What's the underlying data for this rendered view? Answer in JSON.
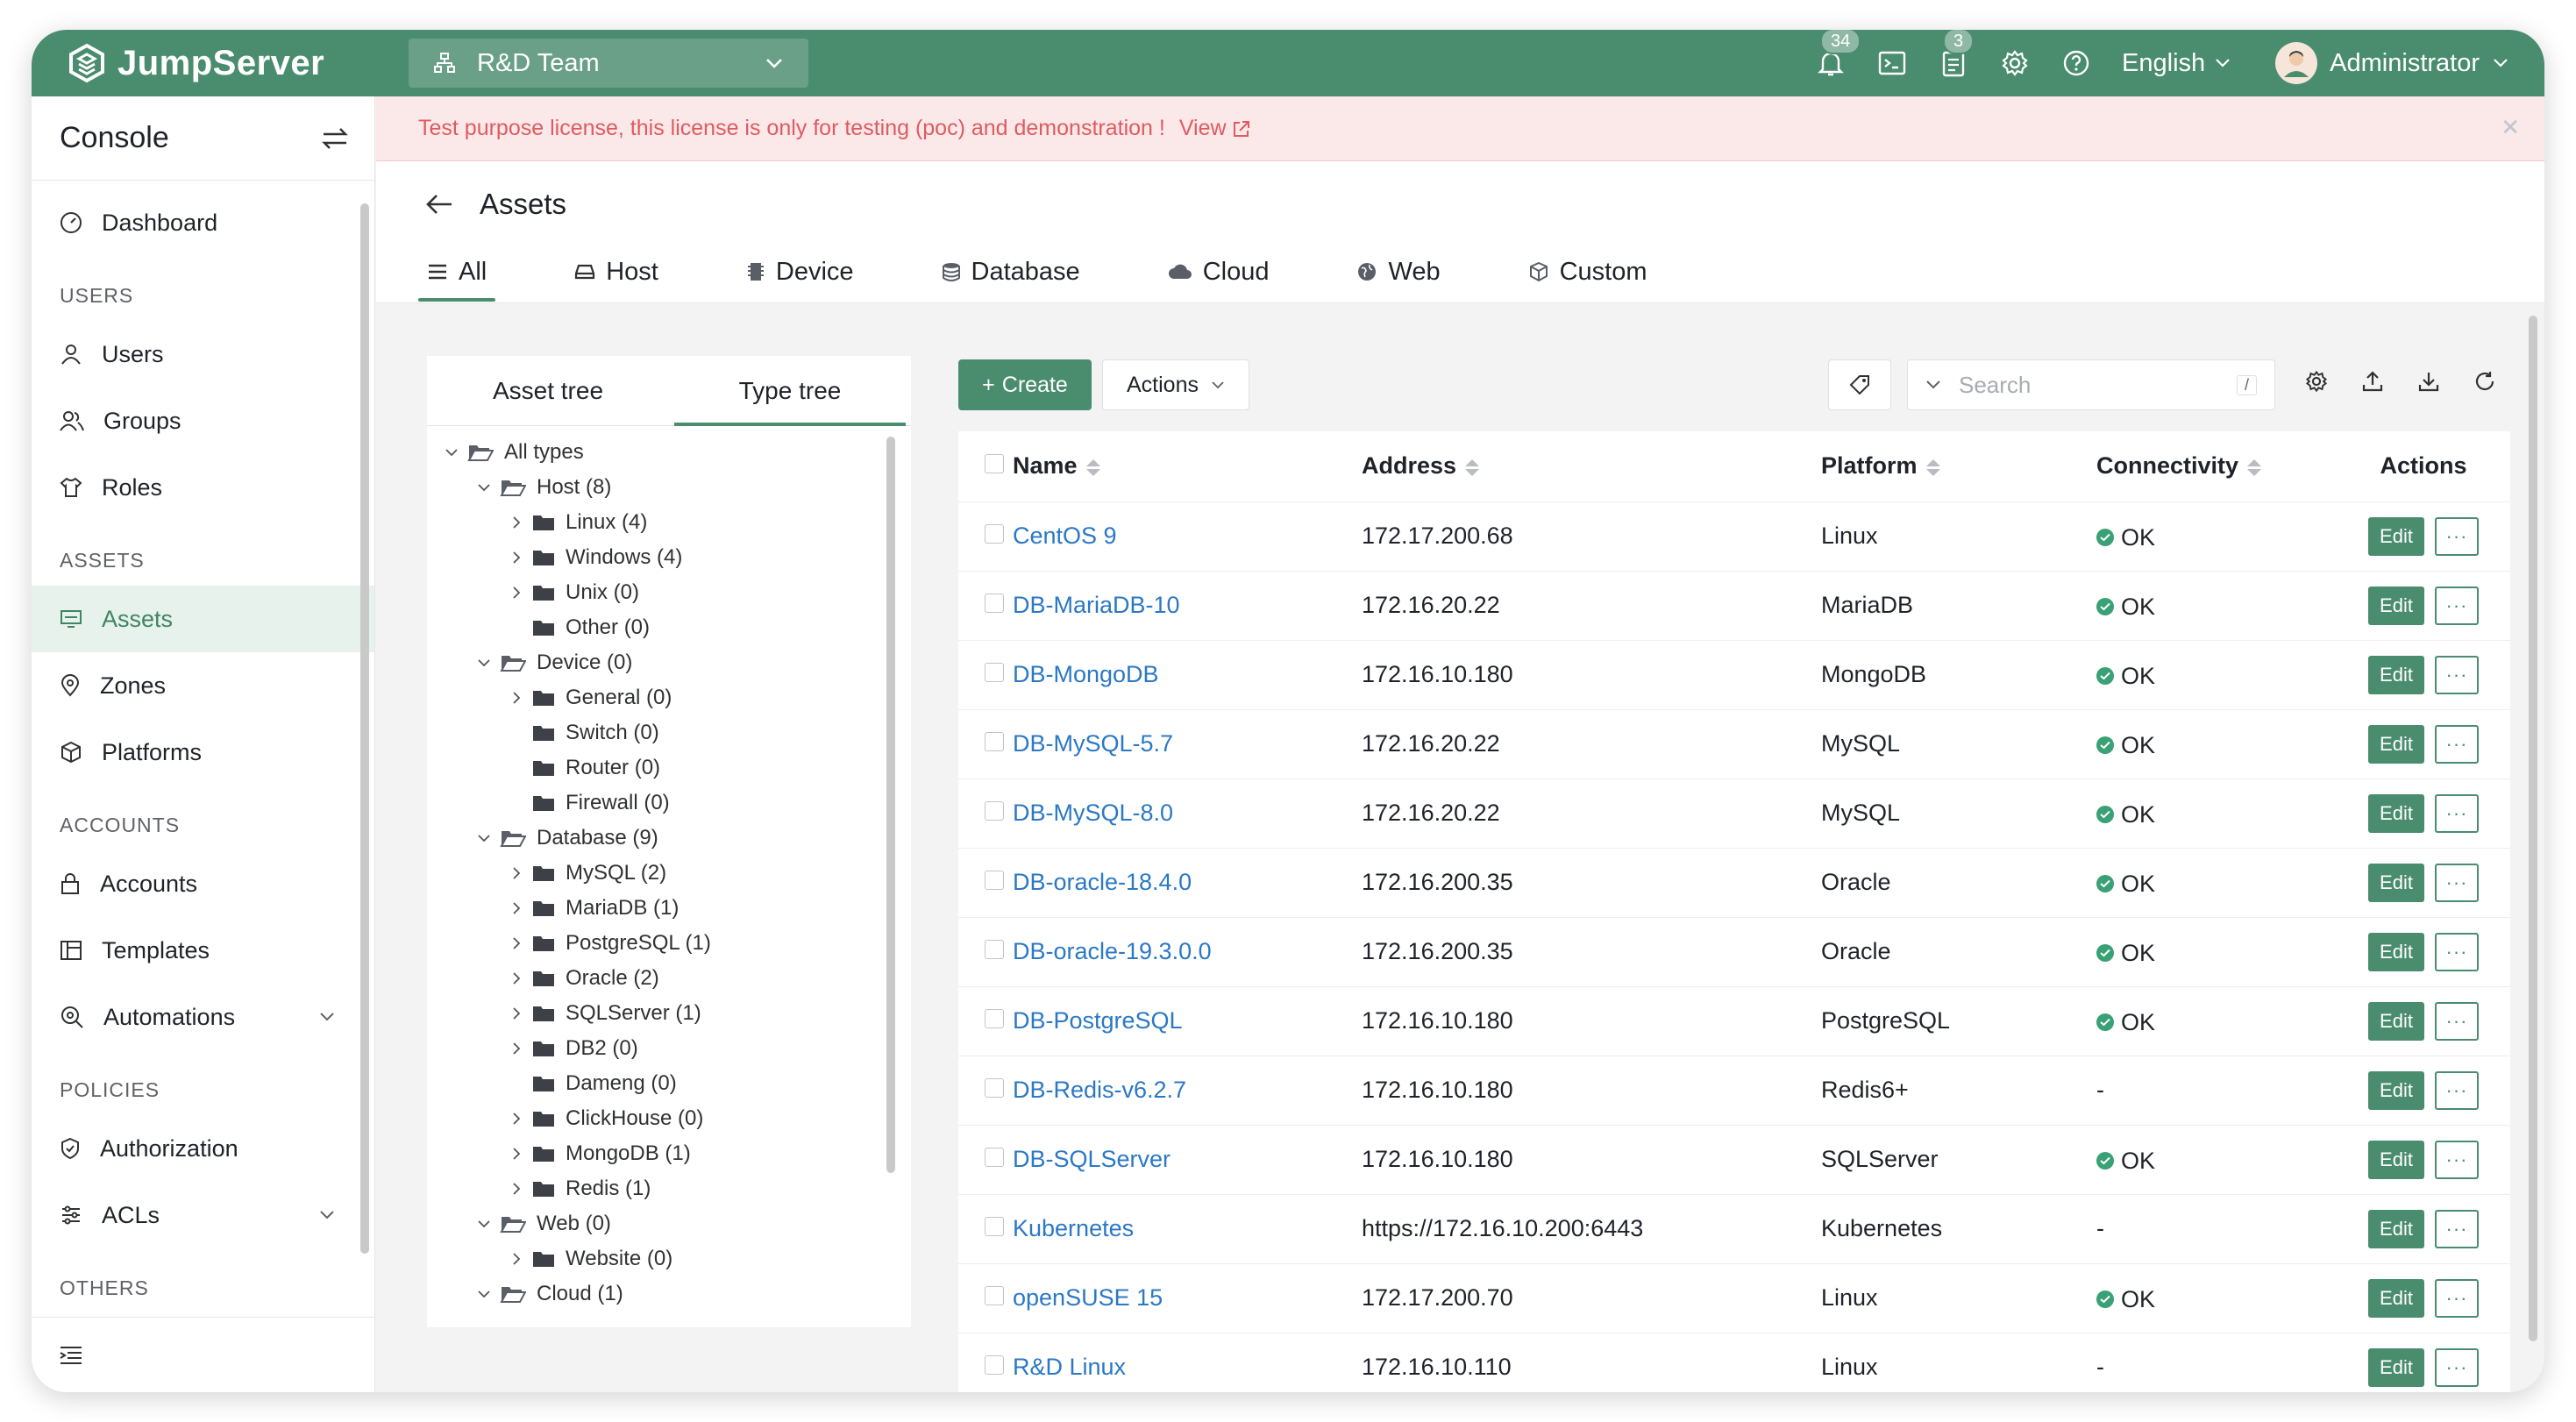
{
  "brand": {
    "name": "JumpServer"
  },
  "org": {
    "name": "R&D Team"
  },
  "header": {
    "notifications_count": "34",
    "tasks_count": "3",
    "language": "English",
    "user_name": "Administrator"
  },
  "sidebar": {
    "title": "Console",
    "sections": {
      "users": "USERS",
      "assets": "ASSETS",
      "accounts": "ACCOUNTS",
      "policies": "POLICIES",
      "others": "OTHERS"
    },
    "items": {
      "dashboard": "Dashboard",
      "users": "Users",
      "groups": "Groups",
      "roles": "Roles",
      "assets": "Assets",
      "zones": "Zones",
      "platforms": "Platforms",
      "accounts": "Accounts",
      "templates": "Templates",
      "automations": "Automations",
      "authorization": "Authorization",
      "acls": "ACLs"
    }
  },
  "license": {
    "message": "Test purpose license, this license is only for testing (poc) and demonstration !",
    "view": "View"
  },
  "page": {
    "title": "Assets",
    "tabs": [
      "All",
      "Host",
      "Device",
      "Database",
      "Cloud",
      "Web",
      "Custom"
    ]
  },
  "tree": {
    "tabs": [
      "Asset tree",
      "Type tree"
    ],
    "nodes": [
      {
        "label": "All types",
        "level": 0,
        "arrow": "down",
        "icon": "folder-open"
      },
      {
        "label": "Host (8)",
        "level": 1,
        "arrow": "down",
        "icon": "folder-open"
      },
      {
        "label": "Linux (4)",
        "level": 2,
        "arrow": "right",
        "icon": "folder"
      },
      {
        "label": "Windows (4)",
        "level": 2,
        "arrow": "right",
        "icon": "folder"
      },
      {
        "label": "Unix (0)",
        "level": 2,
        "arrow": "right",
        "icon": "folder"
      },
      {
        "label": "Other (0)",
        "level": 2,
        "arrow": "none",
        "icon": "folder"
      },
      {
        "label": "Device (0)",
        "level": 1,
        "arrow": "down",
        "icon": "folder-open"
      },
      {
        "label": "General (0)",
        "level": 2,
        "arrow": "right",
        "icon": "folder"
      },
      {
        "label": "Switch (0)",
        "level": 2,
        "arrow": "none",
        "icon": "folder"
      },
      {
        "label": "Router (0)",
        "level": 2,
        "arrow": "none",
        "icon": "folder"
      },
      {
        "label": "Firewall (0)",
        "level": 2,
        "arrow": "none",
        "icon": "folder"
      },
      {
        "label": "Database (9)",
        "level": 1,
        "arrow": "down",
        "icon": "folder-open"
      },
      {
        "label": "MySQL (2)",
        "level": 2,
        "arrow": "right",
        "icon": "folder"
      },
      {
        "label": "MariaDB (1)",
        "level": 2,
        "arrow": "right",
        "icon": "folder"
      },
      {
        "label": "PostgreSQL (1)",
        "level": 2,
        "arrow": "right",
        "icon": "folder"
      },
      {
        "label": "Oracle (2)",
        "level": 2,
        "arrow": "right",
        "icon": "folder"
      },
      {
        "label": "SQLServer (1)",
        "level": 2,
        "arrow": "right",
        "icon": "folder"
      },
      {
        "label": "DB2 (0)",
        "level": 2,
        "arrow": "right",
        "icon": "folder"
      },
      {
        "label": "Dameng (0)",
        "level": 2,
        "arrow": "none",
        "icon": "folder"
      },
      {
        "label": "ClickHouse (0)",
        "level": 2,
        "arrow": "right",
        "icon": "folder"
      },
      {
        "label": "MongoDB (1)",
        "level": 2,
        "arrow": "right",
        "icon": "folder"
      },
      {
        "label": "Redis (1)",
        "level": 2,
        "arrow": "right",
        "icon": "folder"
      },
      {
        "label": "Web (0)",
        "level": 1,
        "arrow": "down",
        "icon": "folder-open"
      },
      {
        "label": "Website (0)",
        "level": 2,
        "arrow": "right",
        "icon": "folder"
      },
      {
        "label": "Cloud (1)",
        "level": 1,
        "arrow": "down",
        "icon": "folder-open"
      }
    ]
  },
  "toolbar": {
    "create": "Create",
    "actions": "Actions",
    "search_placeholder": "Search",
    "search_shortcut": "/"
  },
  "table": {
    "headers": [
      "Name",
      "Address",
      "Platform",
      "Connectivity",
      "Actions"
    ],
    "edit_label": "Edit",
    "more_label": "···",
    "rows": [
      {
        "name": "CentOS 9",
        "address": "172.17.200.68",
        "platform": "Linux",
        "connectivity": "OK"
      },
      {
        "name": "DB-MariaDB-10",
        "address": "172.16.20.22",
        "platform": "MariaDB",
        "connectivity": "OK"
      },
      {
        "name": "DB-MongoDB",
        "address": "172.16.10.180",
        "platform": "MongoDB",
        "connectivity": "OK"
      },
      {
        "name": "DB-MySQL-5.7",
        "address": "172.16.20.22",
        "platform": "MySQL",
        "connectivity": "OK"
      },
      {
        "name": "DB-MySQL-8.0",
        "address": "172.16.20.22",
        "platform": "MySQL",
        "connectivity": "OK"
      },
      {
        "name": "DB-oracle-18.4.0",
        "address": "172.16.200.35",
        "platform": "Oracle",
        "connectivity": "OK"
      },
      {
        "name": "DB-oracle-19.3.0.0",
        "address": "172.16.200.35",
        "platform": "Oracle",
        "connectivity": "OK"
      },
      {
        "name": "DB-PostgreSQL",
        "address": "172.16.10.180",
        "platform": "PostgreSQL",
        "connectivity": "OK"
      },
      {
        "name": "DB-Redis-v6.2.7",
        "address": "172.16.10.180",
        "platform": "Redis6+",
        "connectivity": "-"
      },
      {
        "name": "DB-SQLServer",
        "address": "172.16.10.180",
        "platform": "SQLServer",
        "connectivity": "OK"
      },
      {
        "name": "Kubernetes",
        "address": "https://172.16.10.200:6443",
        "platform": "Kubernetes",
        "connectivity": "-"
      },
      {
        "name": "openSUSE 15",
        "address": "172.17.200.70",
        "platform": "Linux",
        "connectivity": "OK"
      },
      {
        "name": "R&D Linux",
        "address": "172.16.10.110",
        "platform": "Linux",
        "connectivity": "-"
      }
    ]
  },
  "colors": {
    "brand": "#4a8c6e",
    "link": "#2b78c5",
    "ok": "#3aa075",
    "license_text": "#e05a5f"
  }
}
